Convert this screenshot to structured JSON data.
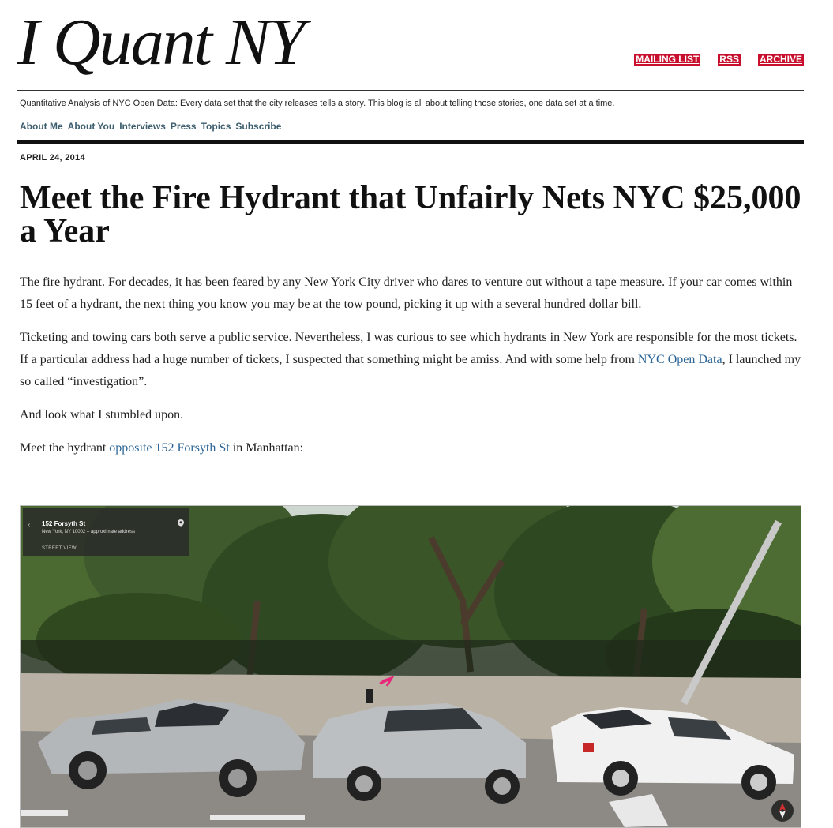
{
  "site": {
    "title": "I Quant NY",
    "tagline": "Quantitative Analysis of NYC Open Data: Every data set that the city releases tells a story. This blog is all about telling those stories, one data set at a time.",
    "top_links": [
      "MAILING LIST",
      "RSS",
      "ARCHIVE"
    ],
    "accent_color": "#c8102e",
    "nav": [
      "About Me",
      "About You",
      "Interviews",
      "Press",
      "Topics",
      "Subscribe"
    ]
  },
  "post": {
    "date": "APRIL 24, 2014",
    "title": "Meet the Fire Hydrant that Unfairly Nets NYC $25,000 a Year",
    "p1": "The fire hydrant.  For decades, it has been feared by any New York City driver who dares to venture out without a tape measure.  If your car comes within 15 feet of a hydrant, the next thing you know you may be at the tow pound, picking it up with a several hundred dollar bill.",
    "p2_before": "Ticketing and towing cars both serve a public service.  Nevertheless, I was curious to see which hydrants in New York are responsible for the most tickets.  If a particular address had a huge number of tickets, I suspected that something might be amiss.  And with some help from ",
    "p2_link": "NYC Open Data",
    "p2_after": ", I launched my so called “investigation”.",
    "p3": "And look what I stumbled upon.",
    "p4_before": "Meet the hydrant ",
    "p4_link": "opposite 152 Forsyth St",
    "p4_after": " in Manhattan:"
  },
  "street_view": {
    "name": "152 Forsyth St",
    "address": "New York, NY 10002 – approximate address",
    "label": "STREET VIEW",
    "back_icon": "chevron-left-icon",
    "pin_icon": "map-pin-icon",
    "compass_icon": "compass-icon"
  }
}
